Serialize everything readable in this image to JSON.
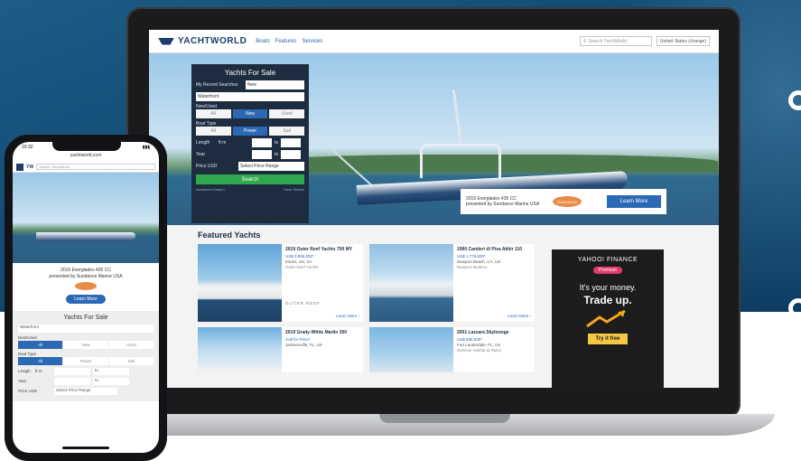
{
  "site": {
    "logo_text": "YACHTWORLD",
    "nav_links": [
      "Boats",
      "Features",
      "Services"
    ],
    "search_placeholder": "Search YachtWorld",
    "locale": "United States (change)"
  },
  "search_panel": {
    "title": "Yachts For Sale",
    "recent_label": "My Recent Searches",
    "recent_value": "New",
    "location_value": "Waterfront",
    "condition_label": "New/Used",
    "condition_options": [
      "All",
      "New",
      "Used"
    ],
    "condition_selected": "New",
    "boat_type_label": "Boat Type",
    "boat_type_options": [
      "All",
      "Power",
      "Sail"
    ],
    "boat_type_selected": "Power",
    "length_label": "Length",
    "length_units": "ft m",
    "year_label": "Year",
    "to_label": "to",
    "price_label": "Price USD",
    "price_select": "Select Price Range",
    "search_button": "Search",
    "advanced_link": "Advanced Search",
    "saved_link": "Save Search"
  },
  "promo": {
    "line1": "2019 Everglades 435 CC",
    "line2": "presented by Sundance Marine USA",
    "logo": "SUNDANCE",
    "button": "Learn More"
  },
  "featured": {
    "title": "Featured Yachts",
    "cards": [
      {
        "name": "2019 Outer Reef Yachts 700 MY",
        "price": "US$ 3,995,000*",
        "location": "Essex, US, VA",
        "broker": "Outer Reef Yachts",
        "brand": "OUTER REEF",
        "more": "Learn More"
      },
      {
        "name": "1990 Cantieri di Pisa Akhir 110",
        "price": "US$ 1,775,000*",
        "location": "Newport Beach, CA, US",
        "broker": "Newport Brokers",
        "brand": "",
        "more": "Learn More"
      },
      {
        "name": "2019 Grady-White Marlin 300",
        "price": "Call for Price*",
        "location": "Jacksonville, FL, US",
        "broker": "",
        "brand": "",
        "more": ""
      },
      {
        "name": "2001 Lazzara Skylounge",
        "price": "US$ 595,000*",
        "location": "Fort Lauderdale, FL, US",
        "broker": "Denison Yachts at Taylor",
        "brand": "",
        "more": ""
      }
    ]
  },
  "ad": {
    "brand": "YAHOO! FINANCE",
    "badge": "Premium",
    "line1": "It's your money.",
    "line2a": "Trade",
    "line2b": "up.",
    "cta": "Try it free"
  },
  "phone": {
    "time": "10:32",
    "url": "yachtworld.com",
    "logo": "YW",
    "search_placeholder": "Search YachtWorld",
    "caption_line1": "2019 Everglades 435 CC",
    "caption_line2": "presented by Sundance Marine USA",
    "button": "Learn More",
    "form_title": "Yachts For Sale",
    "location_value": "Waterfront",
    "condition_label": "New/Used",
    "condition_options": [
      "All",
      "New",
      "Used"
    ],
    "boat_type_label": "Boat Type",
    "boat_type_options": [
      "All",
      "Power",
      "Sail"
    ],
    "length_label": "Length",
    "length_units": "ft m",
    "year_label": "Year",
    "to_label": "to",
    "price_label": "Price USD",
    "price_select": "Select Price Range"
  },
  "colors": {
    "brand_navy": "#1a3d6e",
    "accent_blue": "#2c69b4",
    "search_green": "#2fa84f",
    "panel_dark": "#1e2c40"
  }
}
